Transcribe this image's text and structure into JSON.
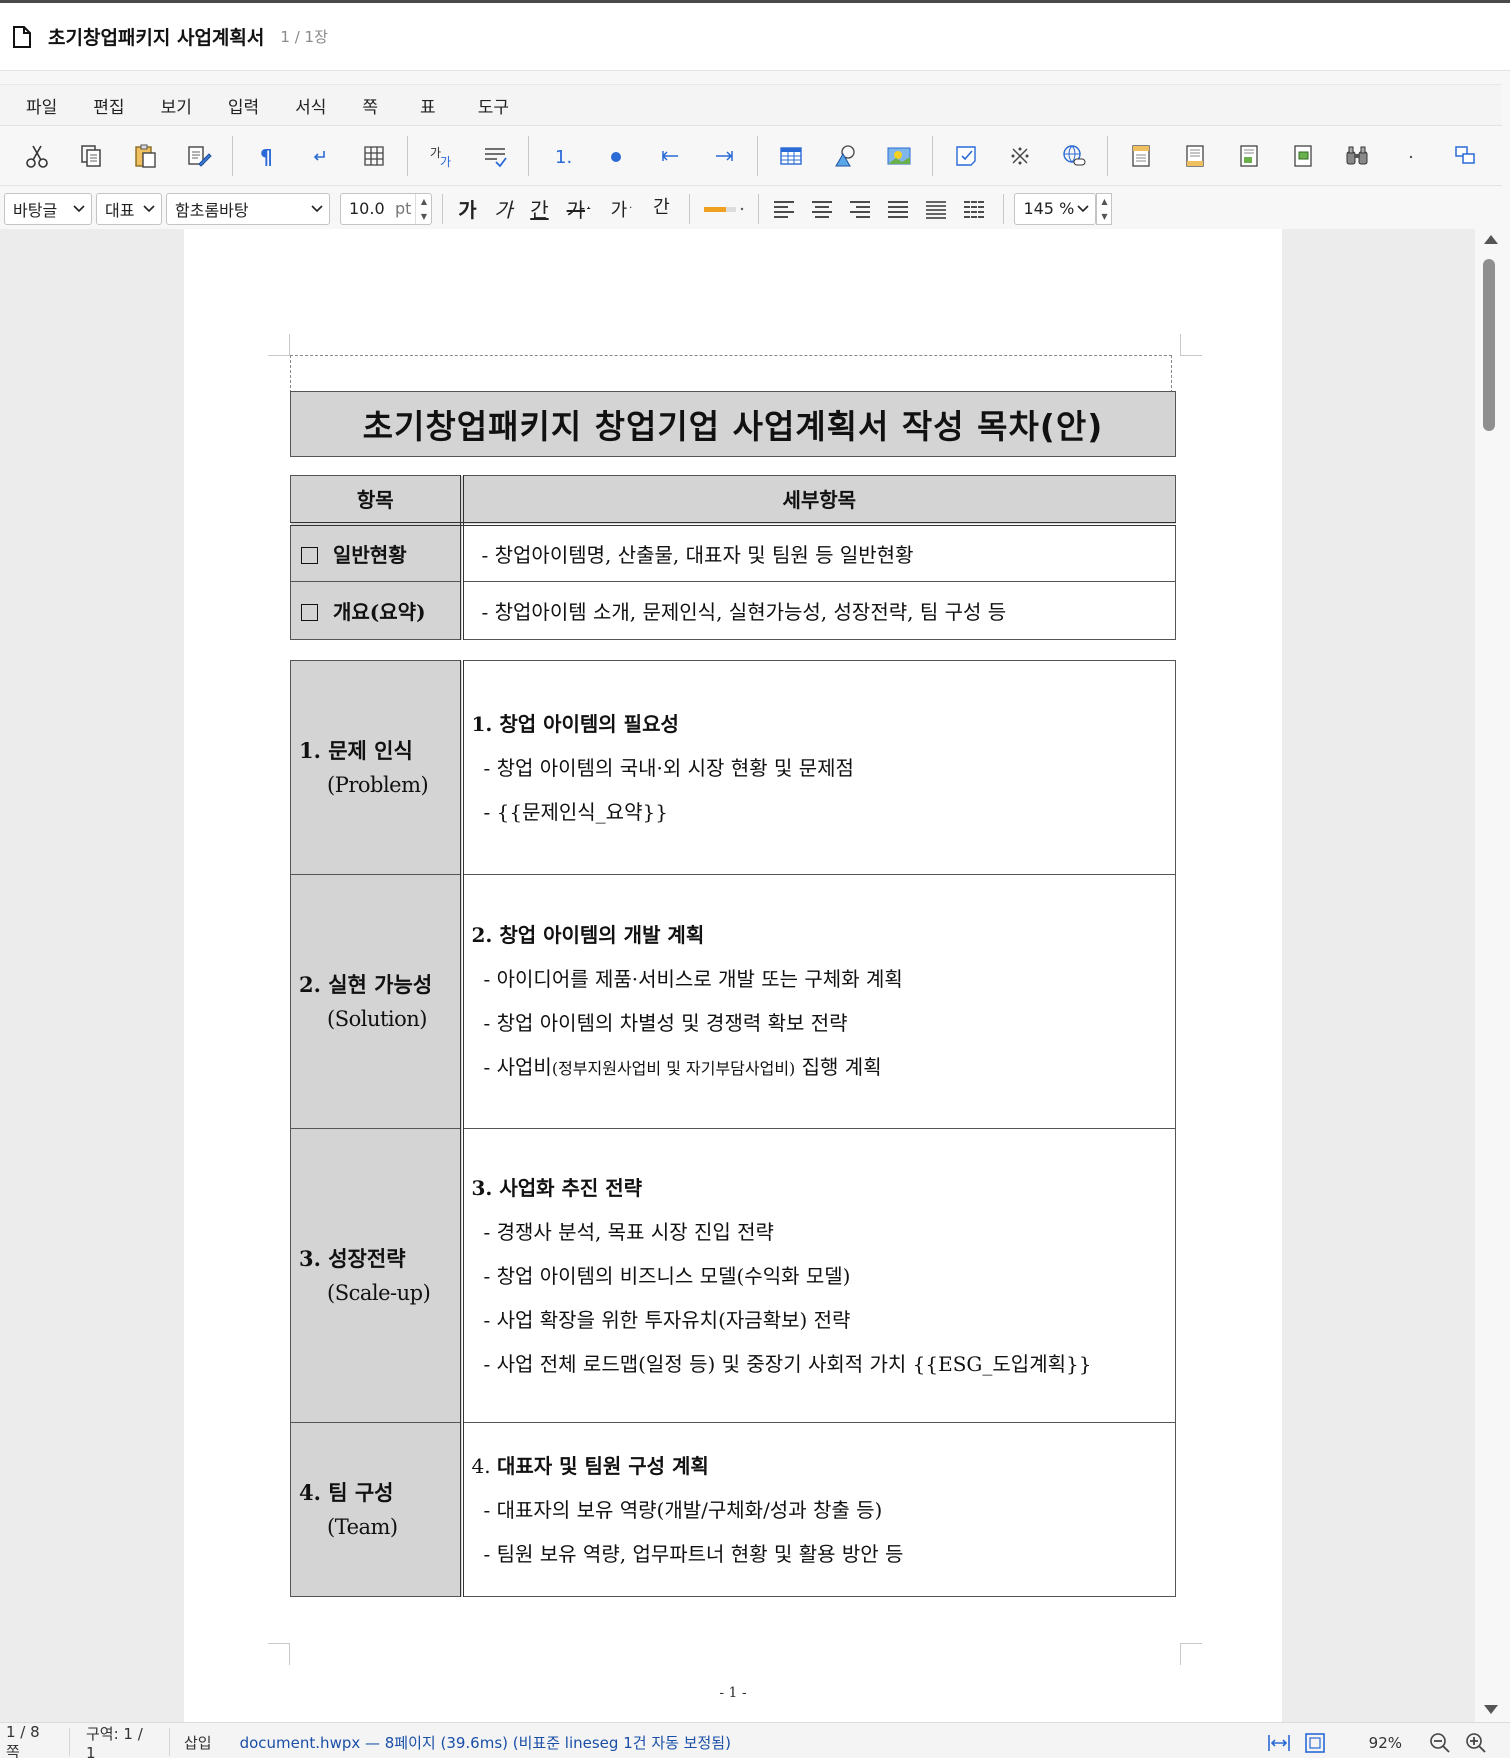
{
  "window": {
    "title": "초기창업패키지 사업계획서",
    "page_info": "1 / 1장"
  },
  "menu": [
    "파일",
    "편집",
    "보기",
    "입력",
    "서식",
    "쪽",
    "표",
    "도구"
  ],
  "toolbar": {
    "style_select": "바탕글",
    "lang_select": "대표",
    "font_select": "함초롬바탕",
    "font_size": "10.0",
    "font_unit": "pt",
    "bold": "가",
    "italic": "가",
    "underline": "간",
    "strike": "가",
    "superscript": "가",
    "shade": "간",
    "zoom_select": "145 %"
  },
  "document": {
    "title": "초기창업패키지 창업기업 사업계획서 작성 목차(안)",
    "header": {
      "col1": "항목",
      "col2": "세부항목"
    },
    "general": [
      {
        "label": "일반현황",
        "detail": "- 창업아이템명, 산출물, 대표자 및 팀원 등 일반현황"
      },
      {
        "label": "개요(요약)",
        "detail": "- 창업아이템 소개, 문제인식, 실현가능성, 성장전략, 팀 구성 등"
      }
    ],
    "sections": [
      {
        "label_ko": "1. 문제 인식",
        "label_en": "(Problem)",
        "heading": "1. 창업 아이템의 필요성",
        "bullets": [
          "- 창업 아이템의 국내·외 시장 현황 및 문제점",
          "- {{문제인식_요약}}"
        ]
      },
      {
        "label_ko": "2. 실현 가능성",
        "label_en": "(Solution)",
        "heading": "2. 창업 아이템의 개발 계획",
        "bullets": [
          "- 아이디어를 제품·서비스로 개발 또는 구체화 계획",
          "- 창업 아이템의 차별성 및 경쟁력 확보 전략"
        ],
        "budget_prefix": "- 사업비",
        "budget_small": "(정부지원사업비 및 자기부담사업비)",
        "budget_suffix": " 집행 계획"
      },
      {
        "label_ko": "3. 성장전략",
        "label_en": "(Scale-up)",
        "heading": "3. 사업화 추진 전략",
        "bullets": [
          "- 경쟁사 분석, 목표 시장 진입 전략",
          "- 창업 아이템의 비즈니스 모델(수익화 모델)",
          "- 사업 확장을 위한 투자유치(자금확보) 전략",
          "- 사업 전체 로드맵(일정 등) 및 중장기 사회적 가치 {{ESG_도입계획}}"
        ]
      },
      {
        "label_ko": "4. 팀 구성",
        "label_en": "(Team)",
        "heading_num": "4.",
        "heading_text": "대표자 및 팀원 구성 계획",
        "bullets": [
          "- 대표자의 보유 역량(개발/구체화/성과 창출 등)",
          "- 팀원 보유 역량, 업무파트너 현황 및 활용 방안 등"
        ]
      }
    ],
    "page_number": "- 1 -"
  },
  "status": {
    "page": "1 / 8 쪽",
    "section": "구역: 1 / 1",
    "mode": "삽입",
    "message": "document.hwpx — 8페이지 (39.6ms) (비표준 lineseg 1건 자동 보정됨)",
    "zoom": "92%"
  }
}
